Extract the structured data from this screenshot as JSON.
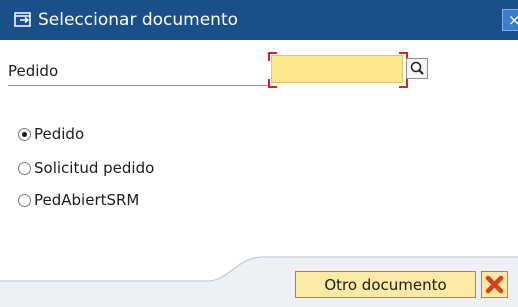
{
  "titlebar": {
    "title": "Seleccionar documento",
    "icon": "select-document-icon",
    "close_glyph": "×",
    "bg_color": "#1a4f8a"
  },
  "field": {
    "label": "Pedido",
    "value": "",
    "required_marker_color": "#e02020",
    "input_color": "#fde68c",
    "search_icon": "search-icon"
  },
  "options": {
    "items": [
      {
        "label": "Pedido",
        "checked": true
      },
      {
        "label": "Solicitud pedido",
        "checked": false
      },
      {
        "label": "PedAbiertSRM",
        "checked": false
      }
    ]
  },
  "footer": {
    "other_document_label": "Otro documento",
    "cancel_icon": "cancel-x-icon",
    "button_color": "#fde9a6"
  }
}
